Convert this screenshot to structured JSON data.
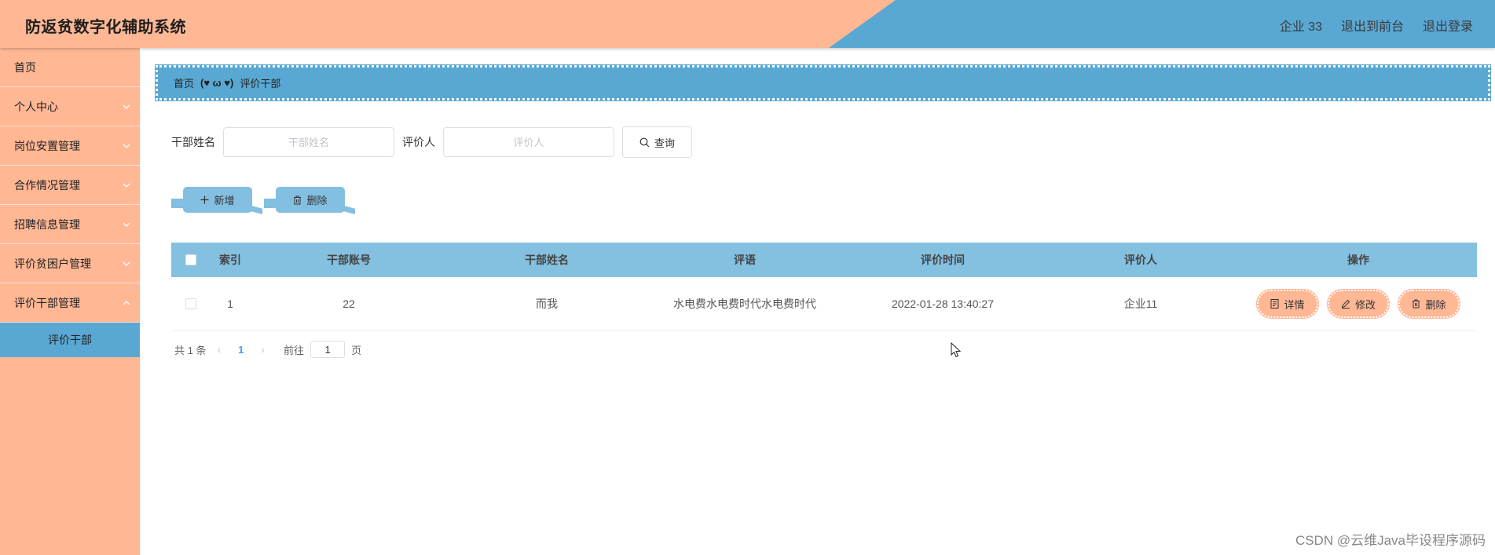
{
  "app": {
    "title": "防返贫数字化辅助系统",
    "user": "企业 33",
    "back_to_front": "退出到前台",
    "logout": "退出登录"
  },
  "sidebar": {
    "items": [
      {
        "label": "首页",
        "has_arrow": false
      },
      {
        "label": "个人中心",
        "has_arrow": true
      },
      {
        "label": "岗位安置管理",
        "has_arrow": true
      },
      {
        "label": "合作情况管理",
        "has_arrow": true
      },
      {
        "label": "招聘信息管理",
        "has_arrow": true
      },
      {
        "label": "评价贫困户管理",
        "has_arrow": true
      },
      {
        "label": "评价干部管理",
        "has_arrow": true
      }
    ],
    "active_sub": "评价干部"
  },
  "breadcrumb": {
    "home": "首页",
    "separator": "(♥ ω ♥)",
    "current": "评价干部"
  },
  "search": {
    "name_label": "干部姓名",
    "name_placeholder": "干部姓名",
    "evaluator_label": "评价人",
    "evaluator_placeholder": "评价人",
    "query_label": "查询"
  },
  "actions": {
    "add_label": "新增",
    "delete_label": "删除"
  },
  "table": {
    "headers": {
      "index": "索引",
      "account": "干部账号",
      "name": "干部姓名",
      "comment": "评语",
      "time": "评价时间",
      "evaluator": "评价人",
      "ops": "操作"
    },
    "rows": [
      {
        "index": "1",
        "account": "22",
        "name": "而我",
        "comment": "水电费水电费时代水电费时代",
        "time": "2022-01-28 13:40:27",
        "evaluator": "企业11"
      }
    ],
    "op_labels": {
      "detail": "详情",
      "edit": "修改",
      "delete": "删除"
    }
  },
  "pagination": {
    "total": "共 1 条",
    "current_page": "1",
    "goto_label": "前往",
    "goto_value": "1",
    "page_suffix": "页"
  },
  "watermark": "CSDN @云维Java毕设程序源码",
  "colors": {
    "accent_orange": "#ffb794",
    "accent_blue": "#59a8d4",
    "table_header": "#84c0e0"
  }
}
